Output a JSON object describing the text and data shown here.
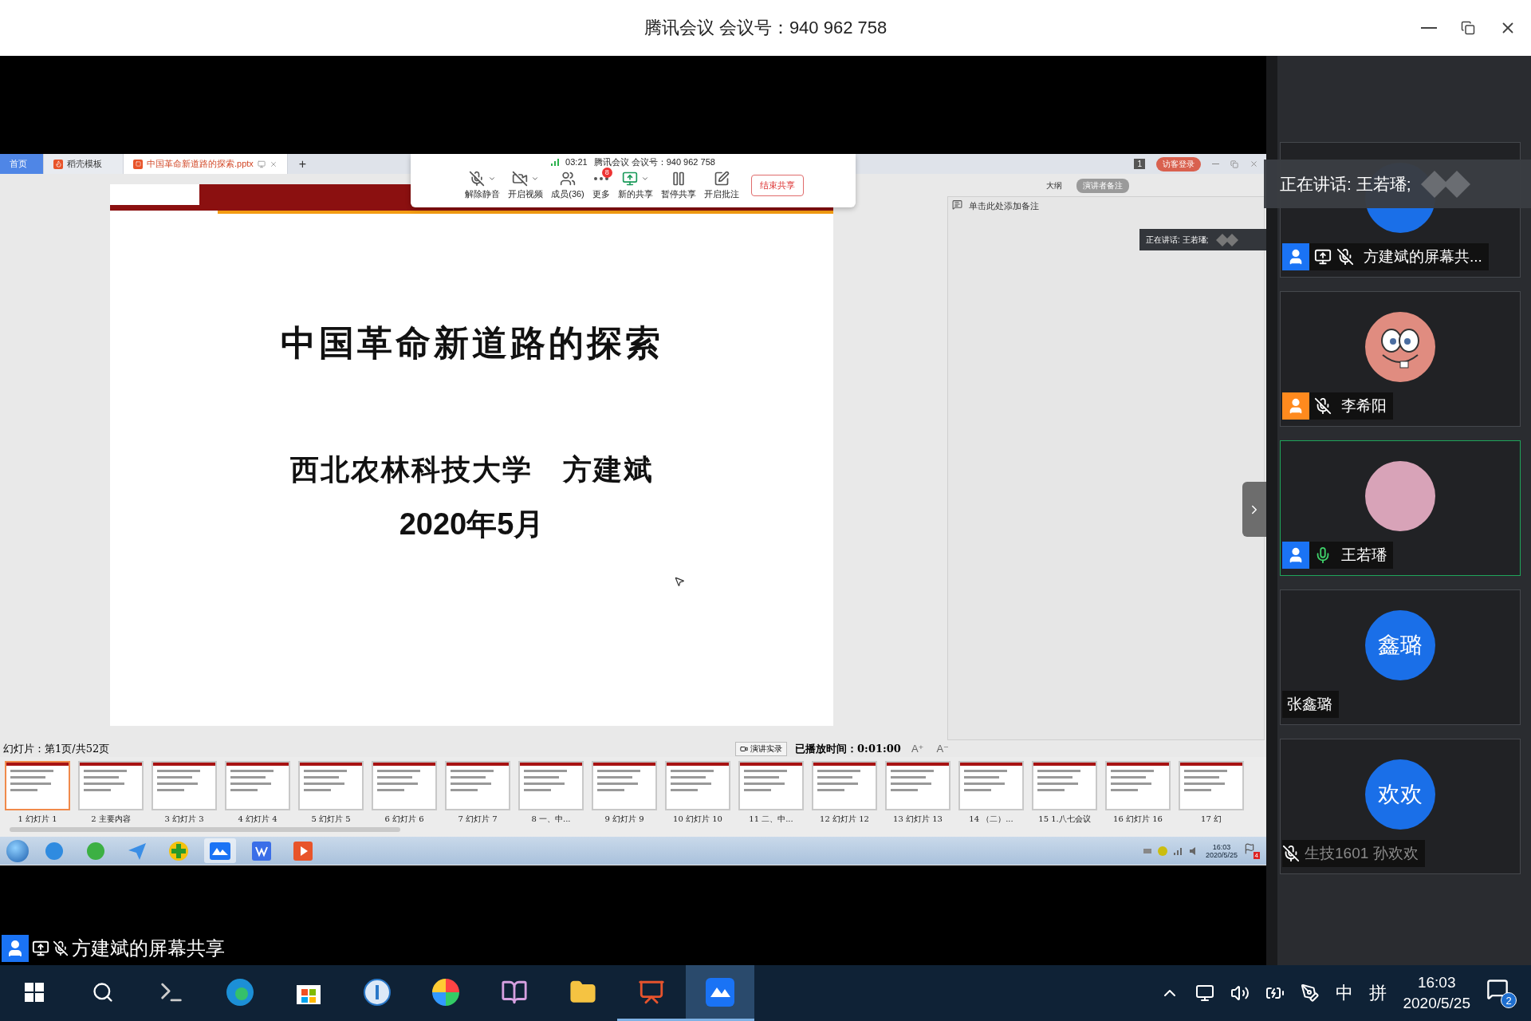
{
  "window": {
    "title": "腾讯会议 会议号：940 962 758"
  },
  "shared_screen": {
    "wps_tabs": [
      {
        "label": "首页",
        "kind": "home",
        "selected": false
      },
      {
        "label": "稻壳模板",
        "kind": "template",
        "selected": false
      },
      {
        "label": "中国革命新道路的探索.pptx",
        "kind": "document",
        "selected": true
      }
    ],
    "new_tab": "+",
    "page_count": "1",
    "login_button": "访客登录",
    "meeting_toolbar": {
      "time": "03:21",
      "meeting_info": "腾讯会议 会议号：940 962 758",
      "buttons": [
        {
          "kind": "mute",
          "label": "解除静音",
          "dropdown": true
        },
        {
          "kind": "video",
          "label": "开启视频",
          "dropdown": true
        },
        {
          "kind": "members",
          "label": "成员(36)",
          "dropdown": false
        },
        {
          "kind": "more",
          "label": "更多",
          "dropdown": false,
          "badge": "8"
        },
        {
          "kind": "share",
          "label": "新的共享",
          "dropdown": true
        },
        {
          "kind": "pause",
          "label": "暂停共享",
          "dropdown": false
        },
        {
          "kind": "annotate",
          "label": "开启批注",
          "dropdown": false
        }
      ],
      "end_button": "结束共享"
    },
    "slide": {
      "title": "中国革命新道路的探索",
      "author_line": "西北农林科技大学　方建斌",
      "date": "2020年5月"
    },
    "notes": {
      "tabs": [
        {
          "label": "大纲",
          "selected": false
        },
        {
          "label": "演讲者备注",
          "selected": true
        }
      ],
      "placeholder": "单击此处添加备注"
    },
    "speaking_toast": "正在讲话: 王若璠;",
    "status": {
      "slide_position": "幻灯片：第1页/共52页",
      "record_button": "演讲实录",
      "elapsed": "已播放时间：0:01:00",
      "font_up": "A⁺",
      "font_down": "A⁻"
    },
    "thumbnails": [
      {
        "number": "1",
        "title": "幻灯片 1",
        "selected": true
      },
      {
        "number": "2",
        "title": "主要内容",
        "selected": false
      },
      {
        "number": "3",
        "title": "幻灯片 3",
        "selected": false
      },
      {
        "number": "4",
        "title": "幻灯片 4",
        "selected": false
      },
      {
        "number": "5",
        "title": "幻灯片 5",
        "selected": false
      },
      {
        "number": "6",
        "title": "幻灯片 6",
        "selected": false
      },
      {
        "number": "7",
        "title": "幻灯片 7",
        "selected": false
      },
      {
        "number": "8",
        "title": "一、中...",
        "selected": false
      },
      {
        "number": "9",
        "title": "幻灯片 9",
        "selected": false
      },
      {
        "number": "10",
        "title": "幻灯片 10",
        "selected": false
      },
      {
        "number": "11",
        "title": "二、中...",
        "selected": false
      },
      {
        "number": "12",
        "title": "幻灯片 12",
        "selected": false
      },
      {
        "number": "13",
        "title": "幻灯片 13",
        "selected": false
      },
      {
        "number": "14",
        "title": "（二）...",
        "selected": false
      },
      {
        "number": "15",
        "title": "1.八七会议",
        "selected": false
      },
      {
        "number": "16",
        "title": "幻灯片 16",
        "selected": false
      },
      {
        "number": "17",
        "title": "幻",
        "selected": false
      }
    ],
    "win7_taskbar": {
      "time": "16:03",
      "date": "2020/5/25",
      "flag_count": "4"
    }
  },
  "share_label": "方建斌的屏幕共享",
  "speaking_banner": "正在讲话: 王若璠;",
  "participants": [
    {
      "name": "方建斌的屏幕共...",
      "kind": "blank",
      "color": "#1a73f5",
      "sharing": true,
      "muted": true,
      "talking": false,
      "speaking": false,
      "dimmed": false
    },
    {
      "name": "李希阳",
      "kind": "cartoon",
      "color": "#ff8a1e",
      "sharing": false,
      "muted": true,
      "talking": false,
      "speaking": false,
      "dimmed": false
    },
    {
      "name": "王若璠",
      "kind": "photo",
      "color": "#1a73f5",
      "sharing": false,
      "muted": false,
      "talking": true,
      "speaking": true,
      "dimmed": false
    },
    {
      "name": "张鑫璐",
      "kind": "initials",
      "avatar_text": "鑫璐",
      "sharing": false,
      "muted": false,
      "talking": false,
      "speaking": false,
      "dimmed": false
    },
    {
      "name": "生技1601 孙欢欢",
      "kind": "initials",
      "avatar_text": "欢欢",
      "sharing": false,
      "muted": true,
      "talking": false,
      "speaking": false,
      "dimmed": true
    }
  ],
  "taskbar": {
    "apps": [
      {
        "running": false,
        "selected": false
      },
      {
        "running": false,
        "selected": false
      },
      {
        "running": false,
        "selected": false
      },
      {
        "running": false,
        "selected": false
      },
      {
        "running": false,
        "selected": false
      },
      {
        "running": false,
        "selected": false
      },
      {
        "running": false,
        "selected": false
      },
      {
        "running": false,
        "selected": false
      },
      {
        "running": true,
        "selected": false
      },
      {
        "running": true,
        "selected": true
      }
    ],
    "ime_language": "中",
    "ime_mode": "拼",
    "time": "16:03",
    "date": "2020/5/25",
    "notification_count": "2"
  }
}
